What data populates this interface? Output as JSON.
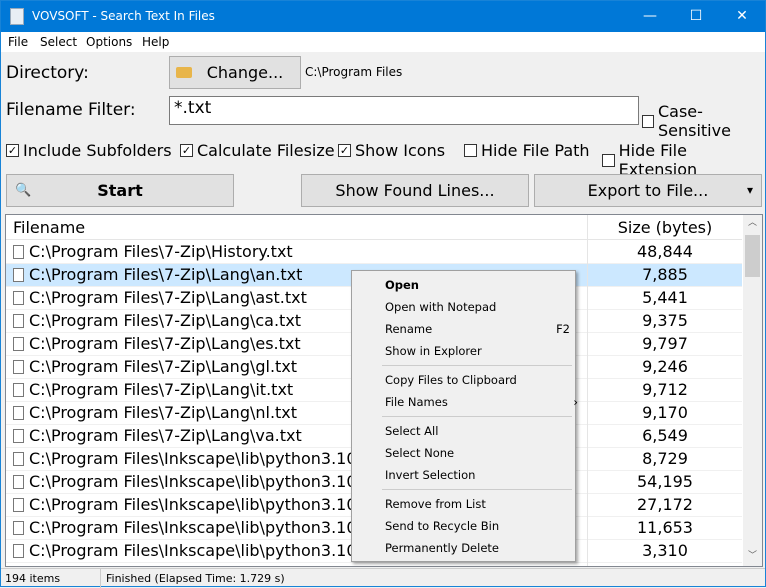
{
  "window": {
    "title": "VOVSOFT - Search Text In Files",
    "minimize": "—",
    "maximize": "☐",
    "close": "✕"
  },
  "menu": [
    "File",
    "Select",
    "Options",
    "Help"
  ],
  "directory": {
    "label": "Directory:",
    "button": "Change...",
    "path": "C:\\Program Files"
  },
  "filter": {
    "label": "Filename Filter:",
    "value": "*.txt",
    "case_sensitive": {
      "label": "Case-Sensitive",
      "checked": false
    }
  },
  "options": [
    {
      "label": "Include Subfolders",
      "checked": true
    },
    {
      "label": "Calculate Filesize",
      "checked": true
    },
    {
      "label": "Show Icons",
      "checked": true
    },
    {
      "label": "Hide File Path",
      "checked": false
    },
    {
      "label": "Hide File Extension",
      "checked": false
    }
  ],
  "actions": {
    "start": "Start",
    "show_lines": "Show Found Lines...",
    "export": "Export to File...",
    "export_arrow": "▾"
  },
  "list": {
    "columns": [
      "Filename",
      "Size (bytes)"
    ],
    "rows": [
      [
        "C:\\Program Files\\7-Zip\\History.txt",
        "48,844"
      ],
      [
        "C:\\Program Files\\7-Zip\\Lang\\an.txt",
        "7,885"
      ],
      [
        "C:\\Program Files\\7-Zip\\Lang\\ast.txt",
        "5,441"
      ],
      [
        "C:\\Program Files\\7-Zip\\Lang\\ca.txt",
        "9,375"
      ],
      [
        "C:\\Program Files\\7-Zip\\Lang\\es.txt",
        "9,797"
      ],
      [
        "C:\\Program Files\\7-Zip\\Lang\\gl.txt",
        "9,246"
      ],
      [
        "C:\\Program Files\\7-Zip\\Lang\\it.txt",
        "9,712"
      ],
      [
        "C:\\Program Files\\7-Zip\\Lang\\nl.txt",
        "9,170"
      ],
      [
        "C:\\Program Files\\7-Zip\\Lang\\va.txt",
        "6,549"
      ],
      [
        "C:\\Program Files\\Inkscape\\lib\\python3.10\\idl",
        "8,729"
      ],
      [
        "C:\\Program Files\\Inkscape\\lib\\python3.10\\idl",
        "54,195"
      ],
      [
        "C:\\Program Files\\Inkscape\\lib\\python3.10\\idl",
        "27,172"
      ],
      [
        "C:\\Program Files\\Inkscape\\lib\\python3.10\\idl",
        "11,653"
      ],
      [
        "C:\\Program Files\\Inkscape\\lib\\python3.10\\sit",
        "3,310"
      ]
    ],
    "selected_index": 1
  },
  "status": {
    "count": "194 items",
    "message": "Finished (Elapsed Time: 1.729 s)"
  },
  "context_menu": {
    "items": [
      {
        "label": "Open",
        "bold": true
      },
      {
        "label": "Open with Notepad"
      },
      {
        "label": "Rename",
        "shortcut": "F2"
      },
      {
        "label": "Show in Explorer"
      },
      {
        "label": "Copy Files to Clipboard"
      },
      {
        "label": "File Names",
        "submenu": "›"
      },
      {
        "label": "Select All"
      },
      {
        "label": "Select None"
      },
      {
        "label": "Invert Selection"
      },
      {
        "label": "Remove from List"
      },
      {
        "label": "Send to Recycle Bin"
      },
      {
        "label": "Permanently Delete"
      }
    ]
  },
  "colors": {
    "titlebar": "#0078d7",
    "selection": "#cce8ff"
  }
}
